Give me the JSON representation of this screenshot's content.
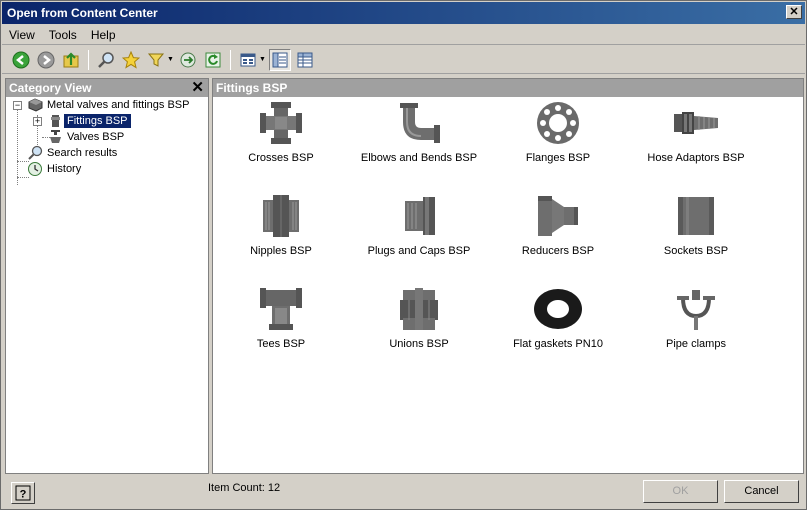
{
  "window": {
    "title": "Open from Content Center"
  },
  "menu": [
    {
      "label": "View"
    },
    {
      "label": "Tools"
    },
    {
      "label": "Help"
    }
  ],
  "toolbar": {
    "icons": [
      "back-icon",
      "forward-icon",
      "up-folder-icon",
      "search-icon",
      "favorites-star-icon",
      "filter-icon",
      "refresh-link-icon",
      "refresh-icon",
      "view-options-icon",
      "tree-view-icon",
      "table-view-icon"
    ]
  },
  "category_view": {
    "title": "Category View",
    "tree": [
      {
        "label": "Metal valves and fittings BSP",
        "level": 0,
        "expanded": true,
        "selected": false
      },
      {
        "label": "Fittings BSP",
        "level": 1,
        "expanded": false,
        "selected": true
      },
      {
        "label": "Valves BSP",
        "level": 1,
        "expanded": false,
        "selected": false
      },
      {
        "label": "Search results",
        "level": 0,
        "selected": false
      },
      {
        "label": "History",
        "level": 0,
        "selected": false
      }
    ]
  },
  "content": {
    "title": "Fittings BSP",
    "items": [
      {
        "label": "Crosses BSP",
        "icon": "cross-fitting-icon"
      },
      {
        "label": "Elbows and Bends BSP",
        "icon": "elbow-fitting-icon"
      },
      {
        "label": "Flanges BSP",
        "icon": "flange-icon"
      },
      {
        "label": "Hose Adaptors BSP",
        "icon": "hose-adaptor-icon"
      },
      {
        "label": "Nipples BSP",
        "icon": "nipple-icon"
      },
      {
        "label": "Plugs and Caps BSP",
        "icon": "plug-cap-icon"
      },
      {
        "label": "Reducers BSP",
        "icon": "reducer-icon"
      },
      {
        "label": "Sockets BSP",
        "icon": "socket-icon"
      },
      {
        "label": "Tees BSP",
        "icon": "tee-fitting-icon"
      },
      {
        "label": "Unions BSP",
        "icon": "union-icon"
      },
      {
        "label": "Flat gaskets PN10",
        "icon": "flat-gasket-icon"
      },
      {
        "label": "Pipe clamps",
        "icon": "pipe-clamp-icon"
      }
    ]
  },
  "status": {
    "item_count": "Item Count: 12"
  },
  "buttons": {
    "ok": "OK",
    "cancel": "Cancel"
  },
  "colors": {
    "title_bar": "#0a246a",
    "selection": "#0a246a",
    "panel_header": "#a0a0a0",
    "part_gray": "#6e6e6e"
  }
}
